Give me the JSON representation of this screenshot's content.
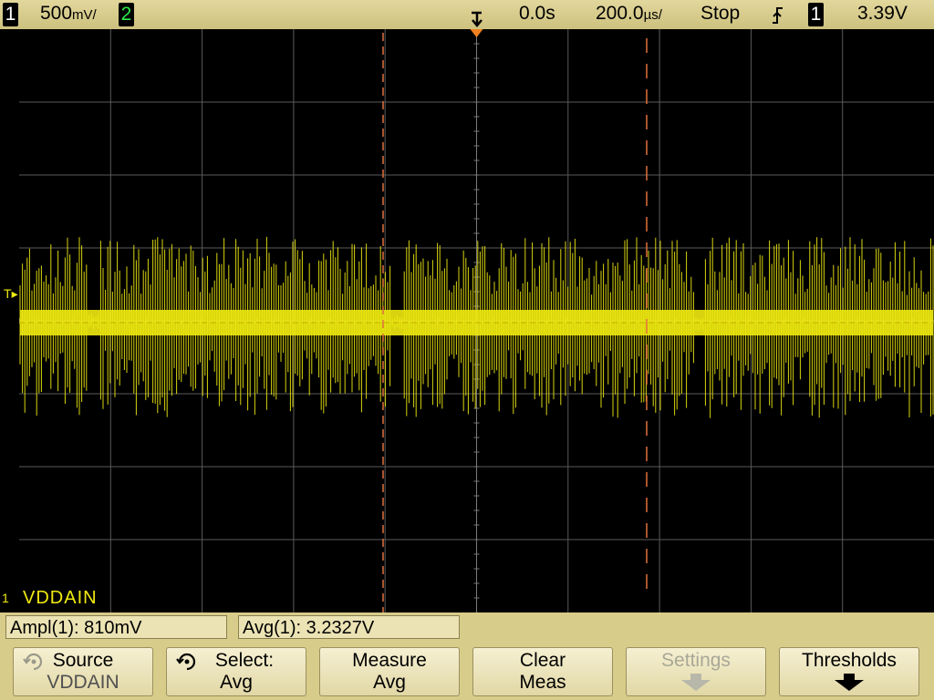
{
  "topbar": {
    "ch1_number": "1",
    "ch1_scale": "500",
    "ch1_scale_unit": "mV/",
    "ch2_number": "2",
    "trigger_marker_icon": "trigger-position-icon",
    "time_ref": "0.0s",
    "time_base": "200.0",
    "time_base_unit": "µs/",
    "run_state": "Stop",
    "trigger_slope_icon": "rising-edge-icon",
    "trigger_source": "1",
    "trigger_level": "3.39V"
  },
  "screen": {
    "trigger_level_marker": "T",
    "ground_marker": "1",
    "channel_label": "VDDAIN",
    "trace_color": "#f0ea10",
    "cursor_color": "#e0703a"
  },
  "measurements": {
    "ampl": "Ampl(1): 810mV",
    "avg": "Avg(1): 3.2327V"
  },
  "softkeys": {
    "source_line1": "Source",
    "source_line2": "VDDAIN",
    "select_line1": "Select:",
    "select_line2": "Avg",
    "measure_line1": "Measure",
    "measure_line2": "Avg",
    "clear_line1": "Clear",
    "clear_line2": "Meas",
    "settings_label": "Settings",
    "thresholds_label": "Thresholds"
  }
}
